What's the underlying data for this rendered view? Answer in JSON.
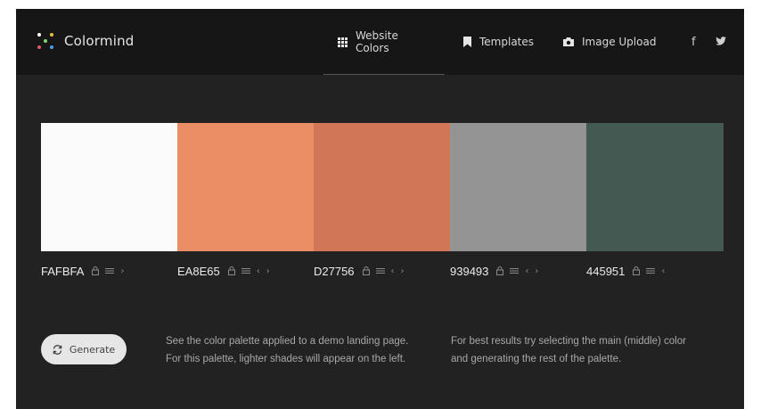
{
  "brand": {
    "name": "Colormind",
    "logo_colors": [
      "#ffffff",
      "#e9c23a",
      "#8bd36a",
      "#e05a63",
      "#4f9ee3"
    ]
  },
  "nav": {
    "items": [
      {
        "label": "Website Colors",
        "icon": "grid-icon",
        "active": true
      },
      {
        "label": "Templates",
        "icon": "bookmark-icon",
        "active": false
      },
      {
        "label": "Image Upload",
        "icon": "camera-icon",
        "active": false
      }
    ],
    "social": {
      "facebook": "f",
      "twitter": "twitter-bird"
    }
  },
  "palette": [
    {
      "hex": "FAFBFA",
      "color": "#FAFBFA",
      "controls": [
        "lock-icon",
        "sliders-icon",
        "chevron-right-icon"
      ]
    },
    {
      "hex": "EA8E65",
      "color": "#EA8E65",
      "controls": [
        "lock-icon",
        "sliders-icon",
        "chevron-left-icon",
        "chevron-right-icon"
      ]
    },
    {
      "hex": "D27756",
      "color": "#D27756",
      "controls": [
        "lock-icon",
        "sliders-icon",
        "chevron-left-icon",
        "chevron-right-icon"
      ]
    },
    {
      "hex": "939493",
      "color": "#939493",
      "controls": [
        "lock-icon",
        "sliders-icon",
        "chevron-left-icon",
        "chevron-right-icon"
      ]
    },
    {
      "hex": "445951",
      "color": "#445951",
      "controls": [
        "lock-icon",
        "sliders-icon",
        "chevron-left-icon"
      ]
    }
  ],
  "generate": {
    "label": "Generate",
    "icon": "refresh-icon"
  },
  "info": {
    "left": [
      "See the color palette applied to a demo landing page.",
      "For this palette, lighter shades will appear on the left."
    ],
    "right": [
      "For best results try selecting the main (middle) color",
      "and generating the rest of the palette."
    ]
  },
  "colors": {
    "frame_bg": "#222222",
    "header_bg": "#161616",
    "text": "#e6e6e6",
    "muted": "#a8a8a8",
    "button_bg": "#e6e6e6"
  }
}
